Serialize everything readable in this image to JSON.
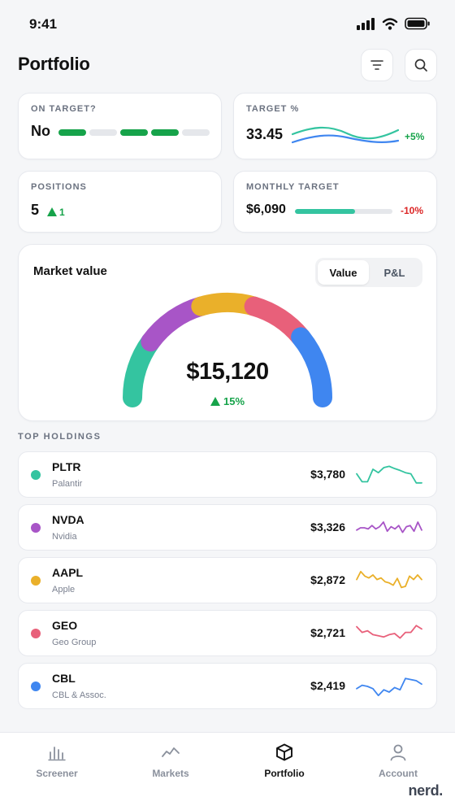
{
  "status_bar": {
    "time": "9:41"
  },
  "header": {
    "title": "Portfolio",
    "icons": [
      "filter-icon",
      "search-icon"
    ]
  },
  "kpis": {
    "on_target": {
      "label": "ON TARGET?",
      "value": "No",
      "segments": [
        true,
        false,
        true,
        true,
        false
      ]
    },
    "target_pct": {
      "label": "TARGET %",
      "value": "33.45",
      "change": "+5%"
    },
    "positions": {
      "label": "POSITIONS",
      "value": "5",
      "delta": "1"
    },
    "monthly_target": {
      "label": "MONTHLY TARGET",
      "value": "$6,090",
      "change": "-10%",
      "progress": 0.62
    }
  },
  "market_value": {
    "title": "Market value",
    "toggle": {
      "options": [
        "Value",
        "P&L"
      ],
      "selected": "Value"
    },
    "total": "$15,120",
    "change": "15%"
  },
  "holdings": {
    "section_title": "TOP HOLDINGS",
    "items": [
      {
        "ticker": "PLTR",
        "name": "Palantir",
        "value": "$3,780",
        "color": "#34c4a0",
        "spark": [
          0.55,
          0.2,
          0.2,
          0.75,
          0.6,
          0.82,
          0.88,
          0.78,
          0.7,
          0.6,
          0.55,
          0.15,
          0.15
        ]
      },
      {
        "ticker": "NVDA",
        "name": "Nvidia",
        "value": "$3,326",
        "color": "#a855c7",
        "spark": [
          0.4,
          0.5,
          0.5,
          0.45,
          0.6,
          0.45,
          0.55,
          0.75,
          0.35,
          0.55,
          0.45,
          0.6,
          0.3,
          0.55,
          0.6,
          0.35,
          0.75,
          0.4
        ]
      },
      {
        "ticker": "AAPL",
        "name": "Apple",
        "value": "$2,872",
        "color": "#eab02a",
        "spark": [
          0.55,
          0.9,
          0.7,
          0.62,
          0.75,
          0.55,
          0.62,
          0.45,
          0.4,
          0.3,
          0.6,
          0.2,
          0.25,
          0.7,
          0.55,
          0.75,
          0.55
        ]
      },
      {
        "ticker": "GEO",
        "name": "Geo Group",
        "value": "$2,721",
        "color": "#e8607a",
        "spark": [
          0.8,
          0.55,
          0.62,
          0.45,
          0.4,
          0.35,
          0.45,
          0.5,
          0.3,
          0.55,
          0.55,
          0.85,
          0.7
        ]
      },
      {
        "ticker": "CBL",
        "name": "CBL & Assoc.",
        "value": "$2,419",
        "color": "#3f86f0",
        "spark": [
          0.4,
          0.55,
          0.5,
          0.4,
          0.1,
          0.35,
          0.25,
          0.45,
          0.35,
          0.85,
          0.8,
          0.75,
          0.6
        ]
      }
    ]
  },
  "gauge": {
    "segments": [
      {
        "color": "#34c4a0",
        "from": 0,
        "to": 0.2
      },
      {
        "color": "#a855c7",
        "from": 0.2,
        "to": 0.41
      },
      {
        "color": "#eab02a",
        "from": 0.41,
        "to": 0.59
      },
      {
        "color": "#e8607a",
        "from": 0.59,
        "to": 0.78
      },
      {
        "color": "#3f86f0",
        "from": 0.78,
        "to": 1
      }
    ]
  },
  "tabs": [
    {
      "label": "Screener",
      "icon": "bar-chart-icon",
      "active": false
    },
    {
      "label": "Markets",
      "icon": "trend-line-icon",
      "active": false
    },
    {
      "label": "Portfolio",
      "icon": "cube-icon",
      "active": true
    },
    {
      "label": "Account",
      "icon": "user-icon",
      "active": false
    }
  ],
  "brand": "nerd."
}
